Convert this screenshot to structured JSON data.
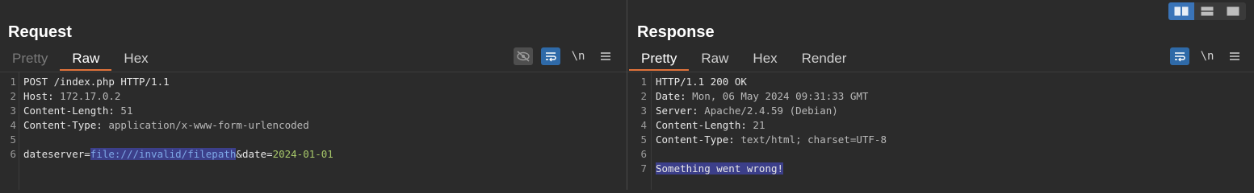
{
  "request": {
    "title": "Request",
    "tabs": [
      "Pretty",
      "Raw",
      "Hex"
    ],
    "active_tab": "Raw",
    "newline_label": "\\n",
    "lines": {
      "l1": "POST /index.php HTTP/1.1",
      "l2_key": "Host:",
      "l2_val": " 172.17.0.2",
      "l3_key": "Content-Length:",
      "l3_val": " 51",
      "l4_key": "Content-Type:",
      "l4_val": " application/x-www-form-urlencoded",
      "l6_a": "dateserver=",
      "l6_b": "file:///invalid/filepath",
      "l6_c": "&date=",
      "l6_d": "2024-01-01"
    },
    "line_numbers": [
      "1",
      "2",
      "3",
      "4",
      "5",
      "6"
    ]
  },
  "response": {
    "title": "Response",
    "tabs": [
      "Pretty",
      "Raw",
      "Hex",
      "Render"
    ],
    "active_tab": "Pretty",
    "newline_label": "\\n",
    "lines": {
      "l1": "HTTP/1.1 200 OK",
      "l2_key": "Date:",
      "l2_val": " Mon, 06 May 2024 09:31:33 GMT",
      "l3_key": "Server:",
      "l3_val": " Apache/2.4.59 (Debian)",
      "l4_key": "Content-Length:",
      "l4_val": " 21",
      "l5_key": "Content-Type:",
      "l5_val": " text/html; charset=UTF-8",
      "l7": "Something went wrong!"
    },
    "line_numbers": [
      "1",
      "2",
      "3",
      "4",
      "5",
      "6",
      "7"
    ]
  },
  "icons": {
    "hide": "eye-off-icon",
    "wrap": "word-wrap-icon",
    "menu": "hamburger-menu-icon",
    "layout": [
      "split-horizontal-icon",
      "split-vertical-icon",
      "single-pane-icon"
    ]
  },
  "colors": {
    "accent": "#e2733b",
    "tool_blue": "#2f6aa8",
    "selection": "#3c3f8a"
  }
}
